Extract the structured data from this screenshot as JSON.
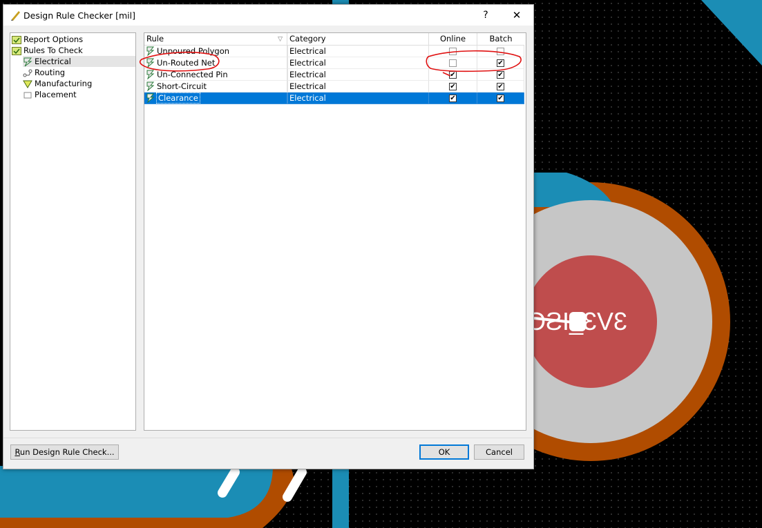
{
  "window": {
    "title": "Design Rule Checker [mil]",
    "help": "?",
    "close": "✕"
  },
  "tree": {
    "items": [
      {
        "label": "Report Options",
        "icon": "report-options-icon"
      },
      {
        "label": "Rules To Check",
        "icon": "rules-to-check-icon"
      },
      {
        "label": "Electrical",
        "icon": "electrical-rule-icon"
      },
      {
        "label": "Routing",
        "icon": "routing-rule-icon"
      },
      {
        "label": "Manufacturing",
        "icon": "manufacturing-rule-icon"
      },
      {
        "label": "Placement",
        "icon": "placement-rule-icon"
      }
    ]
  },
  "grid": {
    "columns": [
      "Rule",
      "Category",
      "Online",
      "Batch"
    ],
    "rows": [
      {
        "rule": "Unpoured Polygon",
        "category": "Electrical",
        "online": false,
        "batch": false
      },
      {
        "rule": "Un-Routed Net",
        "category": "Electrical",
        "online": false,
        "batch": true
      },
      {
        "rule": "Un-Connected Pin",
        "category": "Electrical",
        "online": true,
        "batch": true
      },
      {
        "rule": "Short-Circuit",
        "category": "Electrical",
        "online": true,
        "batch": true
      },
      {
        "rule": "Clearance",
        "category": "Electrical",
        "online": true,
        "batch": true,
        "selected": true
      }
    ]
  },
  "buttons": {
    "run_prefix": "R",
    "run_rest": "un Design Rule Check...",
    "ok": "OK",
    "cancel": "Cancel"
  },
  "pcb": {
    "pad_label": "3V3_ISO"
  },
  "colors": {
    "selection": "#0078d7",
    "pcb_copper": "#b04c00",
    "pcb_blue": "#1b8db5",
    "pad_red": "#bf4d4d",
    "pad_grey": "#c6c6c6",
    "annotation": "#e01010"
  }
}
